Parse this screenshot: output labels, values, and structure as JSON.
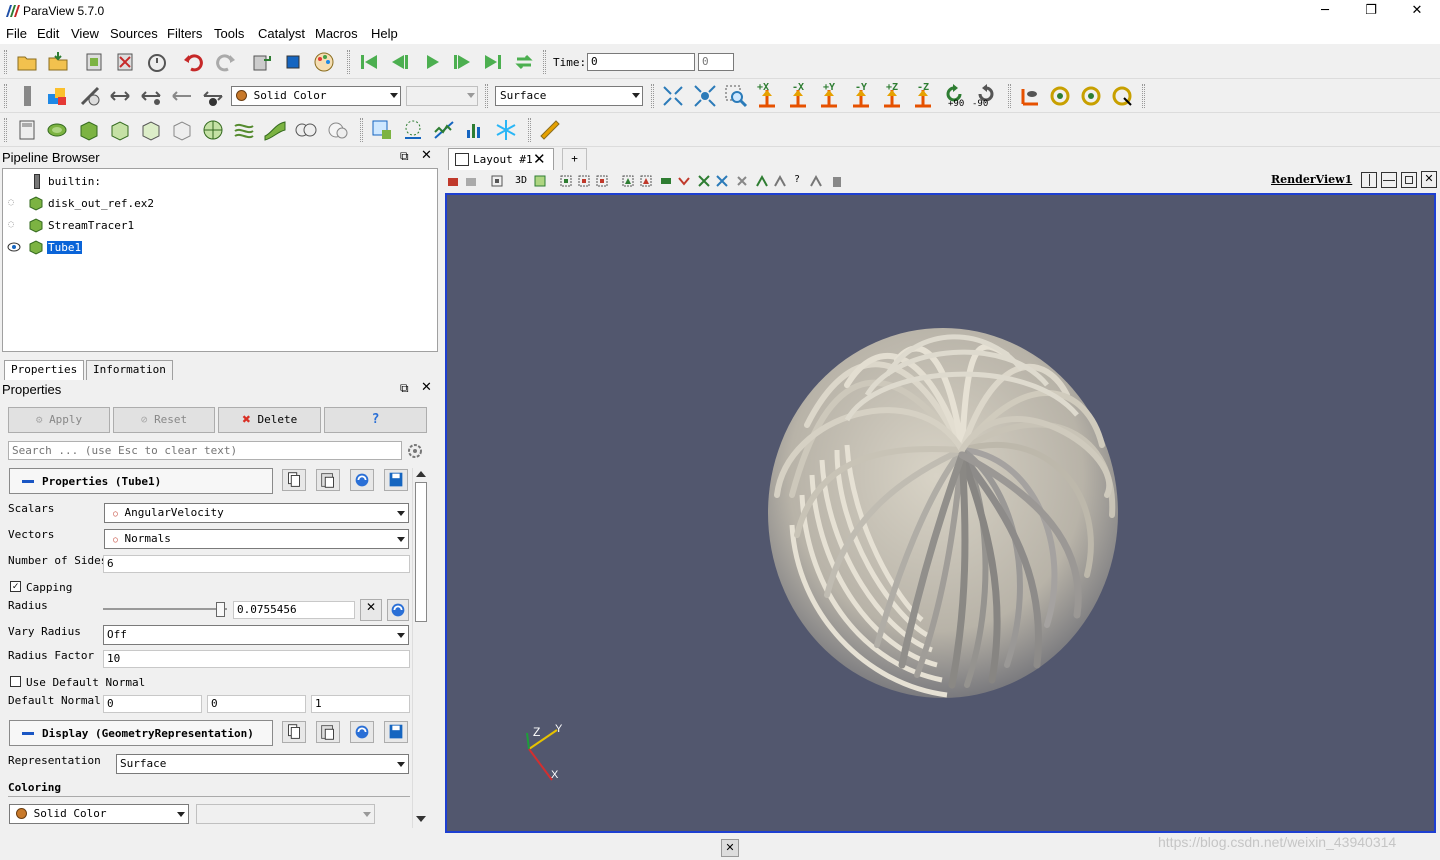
{
  "window": {
    "title": "ParaView 5.7.0",
    "minimize": "─",
    "restore": "❐",
    "close": "✕"
  },
  "menu": [
    "File",
    "Edit",
    "View",
    "Sources",
    "Filters",
    "Tools",
    "Catalyst",
    "Macros",
    "Help"
  ],
  "toolbar": {
    "time_label": "Time:",
    "time_value": "0",
    "time_step": "0",
    "coloring_value": "Solid Color",
    "representation_value": "Surface",
    "camera_rotate_pos": "+90",
    "camera_rotate_neg": "-90",
    "axis_labels": [
      "+X",
      "-X",
      "+Y",
      "-Y",
      "+Z",
      "-Z"
    ]
  },
  "pipeline": {
    "title": "Pipeline Browser",
    "items": [
      {
        "label": "builtin:"
      },
      {
        "label": "disk_out_ref.ex2"
      },
      {
        "label": "StreamTracer1"
      },
      {
        "label": "Tube1"
      }
    ]
  },
  "panel_tabs": [
    "Properties",
    "Information"
  ],
  "properties": {
    "title": "Properties",
    "apply": "Apply",
    "reset": "Reset",
    "delete": "Delete",
    "help": "?",
    "search_placeholder": "Search ... (use Esc to clear text)",
    "section_props": "Properties (Tube1)",
    "scalars_label": "Scalars",
    "scalars_value": "AngularVelocity",
    "vectors_label": "Vectors",
    "vectors_value": "Normals",
    "sides_label": "Number of Sides",
    "sides_value": "6",
    "capping_label": "Capping",
    "radius_label": "Radius",
    "radius_value": "0.0755456",
    "vary_radius_label": "Vary Radius",
    "vary_radius_value": "Off",
    "radius_factor_label": "Radius Factor",
    "radius_factor_value": "10",
    "use_default_normal_label": "Use Default Normal",
    "default_normal_label": "Default Normal",
    "default_normal": [
      "0",
      "0",
      "1"
    ],
    "section_display": "Display (GeometryRepresentation)",
    "representation_label": "Representation",
    "representation_value": "Surface",
    "coloring_label": "Coloring",
    "coloring_value": "Solid Color"
  },
  "layout": {
    "tab_label": "Layout #1",
    "add_tab": "+",
    "view_name": "RenderView1",
    "mode_3d": "3D"
  },
  "axes": {
    "x": "X",
    "y": "Y",
    "z": "Z"
  },
  "watermark": "https://blog.csdn.net/weixin_43940314",
  "colors": {
    "render_bg": "#52576e",
    "render_border": "#1d3fd1",
    "tube": "#d8d3c6",
    "selection": "#0a64d8",
    "delete_icon": "#d93025",
    "help_icon": "#2a6fd6",
    "play_icon": "#4caf50"
  }
}
